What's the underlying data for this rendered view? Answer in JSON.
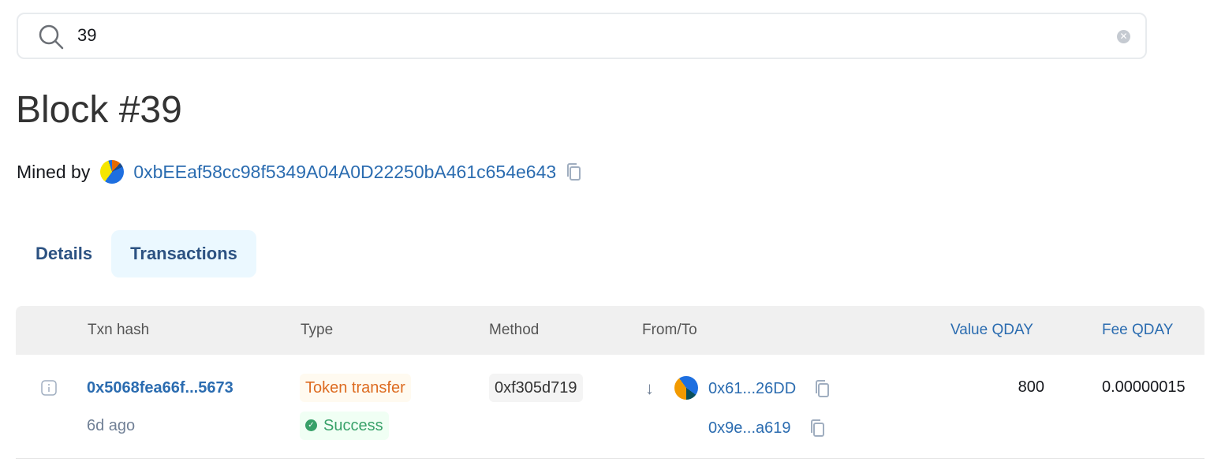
{
  "search": {
    "value": "39"
  },
  "page": {
    "title": "Block #39",
    "mined_by_label": "Mined by",
    "miner_address": "0xbEEaf58cc98f5349A04A0D22250bA461c654e643"
  },
  "tabs": [
    {
      "label": "Details",
      "active": false
    },
    {
      "label": "Transactions",
      "active": true
    }
  ],
  "table": {
    "headers": [
      "Txn hash",
      "Type",
      "Method",
      "From/To",
      "Value QDAY",
      "Fee QDAY"
    ],
    "rows": [
      {
        "hash": "0x5068fea66f...5673",
        "age": "6d ago",
        "type": "Token transfer",
        "status": "Success",
        "method": "0xf305d719",
        "from": "0x61...26DD",
        "to": "0x9e...a619",
        "value": "800",
        "fee": "0.00000015"
      }
    ]
  },
  "colors": {
    "link": "#2b6cb0",
    "type_text": "#dd6b20",
    "type_bg": "#fffaf0",
    "success_text": "#38a169",
    "success_bg": "#f0fff4"
  }
}
